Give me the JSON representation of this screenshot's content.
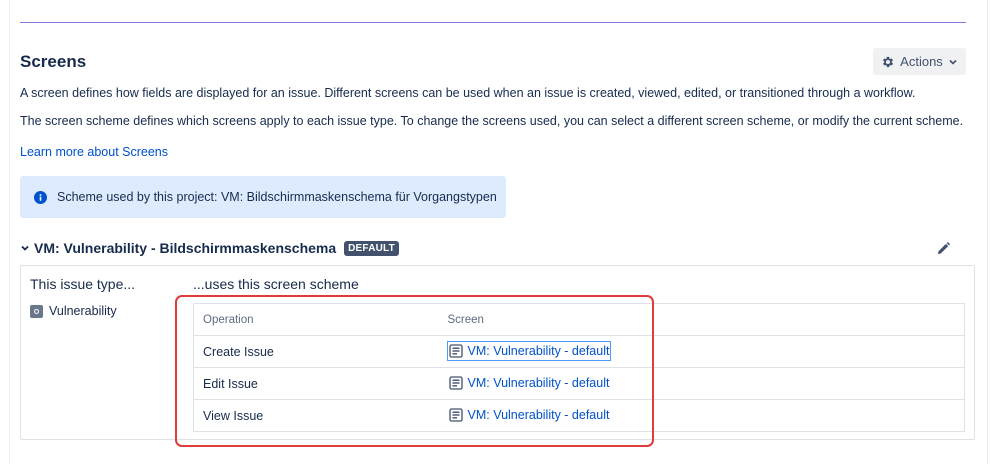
{
  "section": {
    "title": "Screens",
    "actions_label": "Actions",
    "description_1": "A screen defines how fields are displayed for an issue. Different screens can be used when an issue is created, viewed, edited, or transitioned through a workflow.",
    "description_2": "The screen scheme defines which screens apply to each issue type. To change the screens used, you can select a different screen scheme, or modify the current scheme.",
    "learn_more": "Learn more about Screens"
  },
  "info": {
    "text": "Scheme used by this project: VM: Bildschirmmaskenschema für Vorgangstypen"
  },
  "scheme": {
    "title": "VM: Vulnerability - Bildschirmmaskenschema",
    "badge": "DEFAULT",
    "col_issue_type": "This issue type...",
    "col_screen_scheme": "...uses this screen scheme",
    "issue_type": "Vulnerability",
    "table": {
      "headers": [
        "Operation",
        "Screen"
      ],
      "rows": [
        {
          "operation": "Create Issue",
          "screen": "VM: Vulnerability - default"
        },
        {
          "operation": "Edit Issue",
          "screen": "VM: Vulnerability - default"
        },
        {
          "operation": "View Issue",
          "screen": "VM: Vulnerability - default"
        }
      ]
    }
  },
  "colors": {
    "link": "#0052cc",
    "info_bg": "#deebff",
    "info_icon": "#0052cc",
    "highlight": "#e03b3b",
    "accent_line": "#8777d9"
  }
}
